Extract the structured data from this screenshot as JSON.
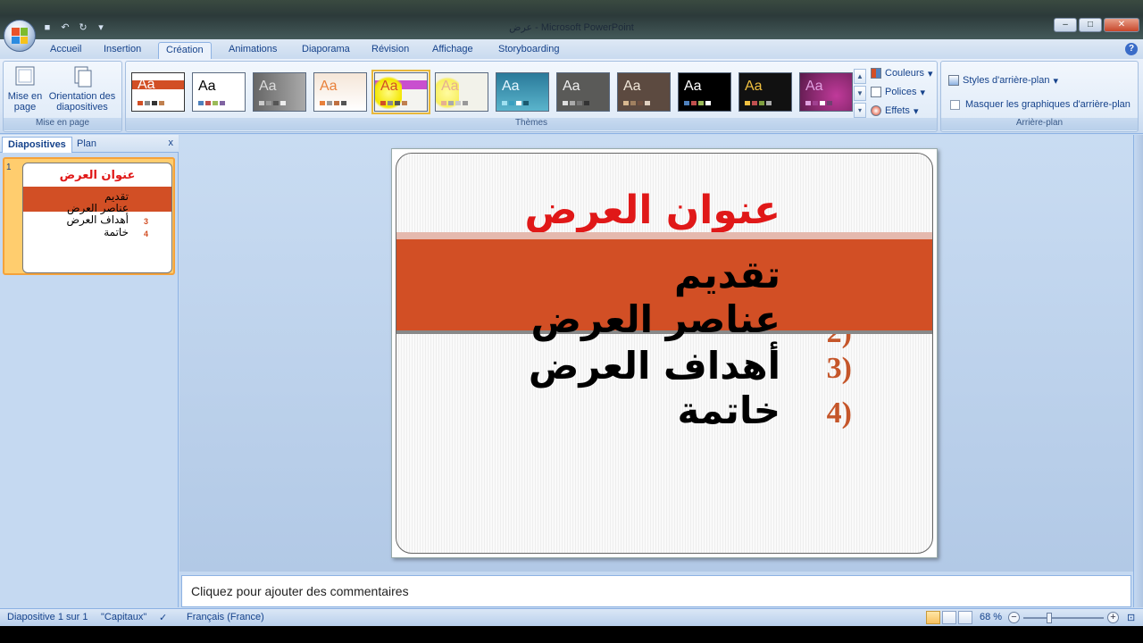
{
  "window": {
    "title": "عرض - Microsoft PowerPoint"
  },
  "tabs": [
    "Accueil",
    "Insertion",
    "Création",
    "Animations",
    "Diaporama",
    "Révision",
    "Affichage",
    "Storyboarding"
  ],
  "active_tab": "Création",
  "ribbon": {
    "mise_en_page": {
      "label": "Mise en page",
      "btn1": "Mise en page",
      "btn2": "Orientation des diapositives"
    },
    "themes": {
      "label": "Thèmes",
      "sample": "Aa",
      "options": [
        "Couleurs",
        "Polices",
        "Effets"
      ]
    },
    "arriere_plan": {
      "label": "Arrière-plan",
      "styles": "Styles d'arrière-plan",
      "masquer": "Masquer les graphiques d'arrière-plan"
    }
  },
  "left_pane": {
    "tabs": [
      "Diapositives",
      "Plan"
    ],
    "close": "x",
    "slide_number": "1"
  },
  "slide": {
    "title": "عنوان العرض",
    "items": [
      "تقديم",
      "عناصر العرض",
      "أهداف العرض",
      "خاتمة"
    ],
    "visible_numbers": [
      "3)",
      "4)"
    ]
  },
  "thumb": {
    "numbers": [
      "3",
      "4"
    ]
  },
  "notes": {
    "placeholder": "Cliquez pour ajouter des commentaires"
  },
  "status": {
    "slide_info": "Diapositive 1 sur 1",
    "theme": "\"Capitaux\"",
    "language": "Français (France)",
    "zoom": "68 %"
  },
  "colors": {
    "accent": "#d24f25",
    "title_red": "#e01818",
    "ribbon": "#dde9f7"
  }
}
